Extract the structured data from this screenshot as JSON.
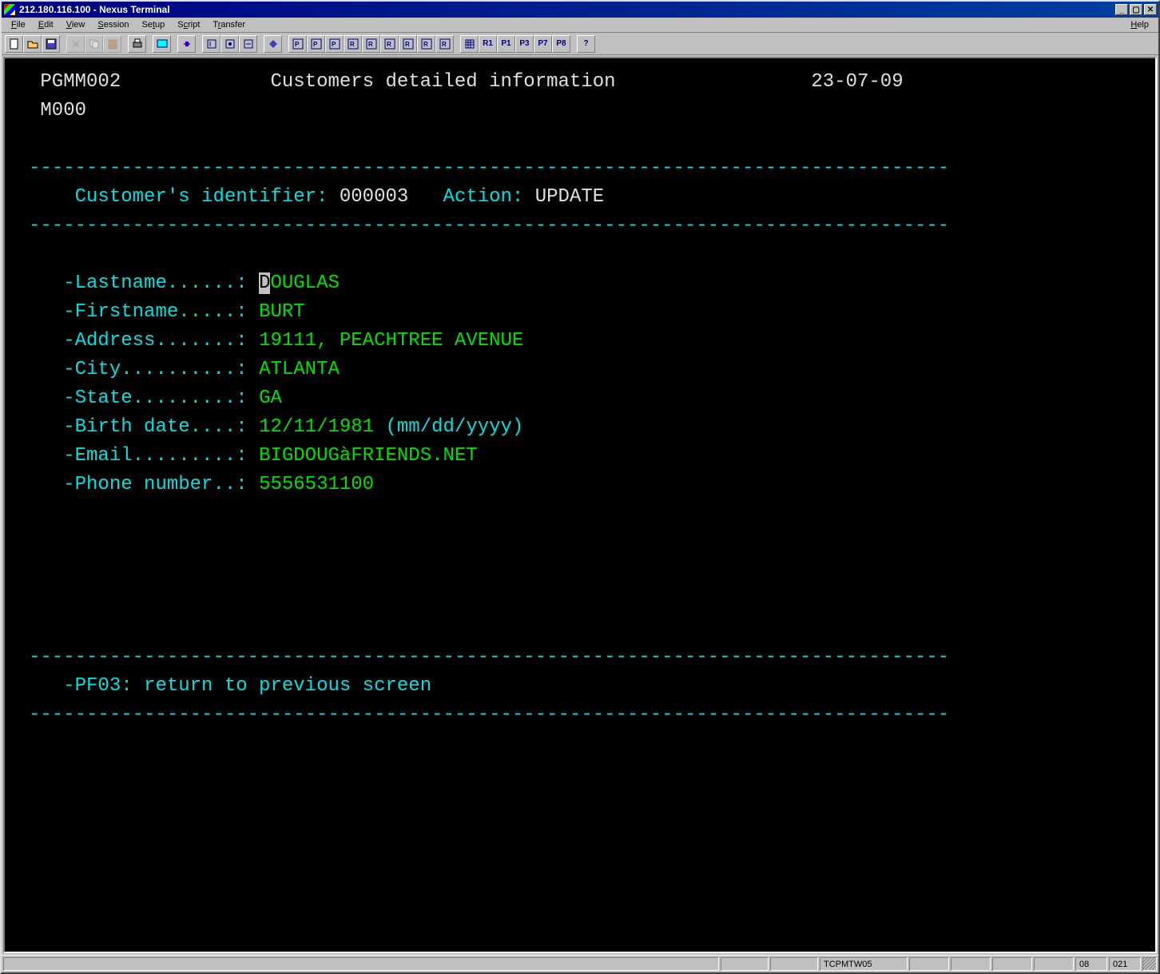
{
  "window": {
    "title": "212.180.116.100 - Nexus Terminal"
  },
  "menu": {
    "file": "File",
    "edit": "Edit",
    "view": "View",
    "session": "Session",
    "setup": "Setup",
    "script": "Script",
    "transfer": "Transfer",
    "help": "Help"
  },
  "toolbar": {
    "r1": "R1",
    "p1": "P1",
    "p3": "P3",
    "p7": "P7",
    "p8": "P8",
    "help": "?"
  },
  "screen": {
    "program": "PGMM002",
    "title": "Customers detailed information",
    "date": "23-07-09",
    "m000": "M000",
    "divider": "--------------------------------------------------------------------------------",
    "cust_id_label": "Customer's identifier:",
    "cust_id_value": "000003",
    "action_label": "Action:",
    "action_value": "UPDATE",
    "fields": {
      "lastname_label": "-Lastname......:",
      "lastname_value": "DOUGLAS",
      "firstname_label": "-Firstname.....:",
      "firstname_value": "BURT",
      "address_label": "-Address.......:",
      "address_value": "19111, PEACHTREE AVENUE",
      "city_label": "-City..........:",
      "city_value": "ATLANTA",
      "state_label": "-State.........:",
      "state_value": "GA",
      "birth_label": "-Birth date....:",
      "birth_value": "12/11/1981",
      "birth_hint": "(mm/dd/yyyy)",
      "email_label": "-Email.........:",
      "email_value": "BIGDOUGàFRIENDS.NET",
      "phone_label": "-Phone number..:",
      "phone_value": "5556531100"
    },
    "footer": "-PF03: return to previous screen"
  },
  "statusbar": {
    "session": "TCPMTW05",
    "row": "08",
    "col": "021"
  }
}
